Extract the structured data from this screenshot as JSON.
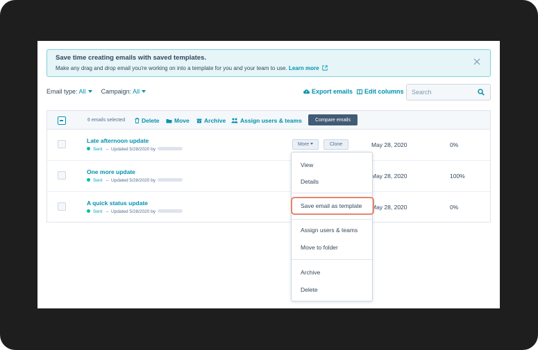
{
  "banner": {
    "title": "Save time creating emails with saved templates.",
    "text": "Make any drag and drop email you're working on into a template for you and your team to use.",
    "link": "Learn more",
    "close_icon": "close-icon"
  },
  "filters": {
    "email_type_label": "Email type:",
    "email_type_value": "All",
    "campaign_label": "Campaign:",
    "campaign_value": "All"
  },
  "toolbar": {
    "export_label": "Export emails",
    "edit_columns_label": "Edit columns",
    "search_placeholder": "Search"
  },
  "bulk_actions": {
    "selected_text": "6 emails selected",
    "delete_label": "Delete",
    "move_label": "Move",
    "archive_label": "Archive",
    "assign_label": "Assign users & teams",
    "compare_label": "Compare emails"
  },
  "rows": [
    {
      "title": "Late afternoon update",
      "status": "Sent",
      "updated": "Updated 5/28/2020 by",
      "date": "May 28, 2020",
      "rate": "0%"
    },
    {
      "title": "One more update",
      "status": "Sent",
      "updated": "Updated 5/28/2020 by",
      "date": "May 28, 2020",
      "rate": "100%"
    },
    {
      "title": "A quick status update",
      "status": "Sent",
      "updated": "Updated 5/28/2020 by",
      "date": "May 28, 2020",
      "rate": "0%"
    }
  ],
  "row_actions": {
    "more_label": "More",
    "clone_label": "Clone"
  },
  "dropdown": {
    "items": [
      "View",
      "Details",
      "Save email as template",
      "Assign users & teams",
      "Move to folder",
      "Archive",
      "Delete"
    ]
  },
  "colors": {
    "accent": "#0091ae",
    "highlight": "#e8836a",
    "status_sent": "#00bda5",
    "frame": "#1e1e1e"
  }
}
